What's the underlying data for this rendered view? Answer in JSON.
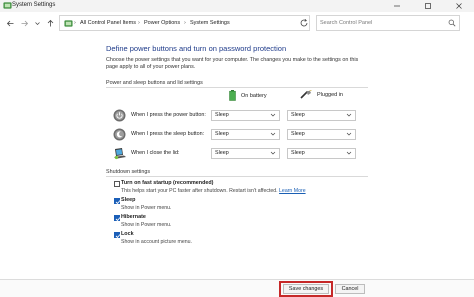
{
  "window": {
    "title": "System Settings",
    "minimize_icon": "minimize-icon",
    "maximize_icon": "maximize-icon",
    "close_icon": "close-icon"
  },
  "addressbar": {
    "breadcrumbs": [
      "All Control Panel Items",
      "Power Options",
      "System Settings"
    ],
    "separator": "›",
    "search_placeholder": "Search Control Panel"
  },
  "page": {
    "heading": "Define power buttons and turn on password protection",
    "description": "Choose the power settings that you want for your computer. The changes you make to the settings on this page apply to all of your power plans.",
    "power_section_label": "Power and sleep buttons and lid settings",
    "columns": {
      "battery": "On battery",
      "plugged": "Plugged in"
    },
    "rows": [
      {
        "label": "When I press the power button:",
        "battery": "Sleep",
        "plugged": "Sleep",
        "icon": "power-button-icon"
      },
      {
        "label": "When I press the sleep button:",
        "battery": "Sleep",
        "plugged": "Sleep",
        "icon": "sleep-button-icon"
      },
      {
        "label": "When I close the lid:",
        "battery": "Sleep",
        "plugged": "Sleep",
        "icon": "laptop-lid-icon"
      }
    ],
    "shutdown_section_label": "Shutdown settings",
    "shutdown_options": [
      {
        "title": "Turn on fast startup (recommended)",
        "desc": "This helps start your PC faster after shutdown. Restart isn't affected.",
        "link": "Learn More",
        "checked": false
      },
      {
        "title": "Sleep",
        "desc": "Show in Power menu.",
        "checked": true
      },
      {
        "title": "Hibernate",
        "desc": "Show in Power menu.",
        "checked": true
      },
      {
        "title": "Lock",
        "desc": "Show in account picture menu.",
        "checked": true
      }
    ]
  },
  "footer": {
    "save_label": "Save changes",
    "cancel_label": "Cancel",
    "highlight_color": "#c62828"
  }
}
